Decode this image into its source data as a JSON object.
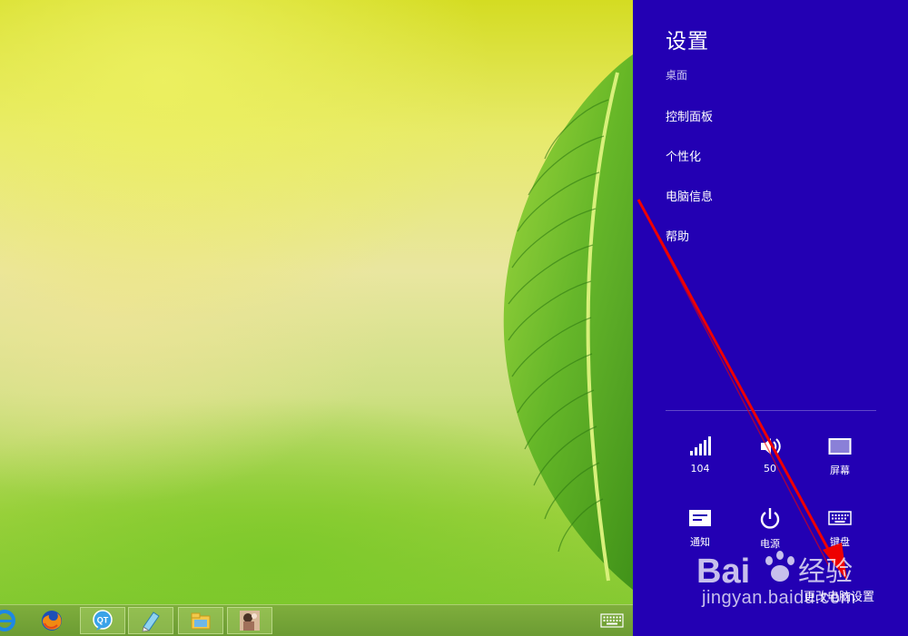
{
  "settings_pane": {
    "title": "设置",
    "subtitle": "桌面",
    "links": [
      {
        "label": "控制面板"
      },
      {
        "label": "个性化"
      },
      {
        "label": "电脑信息"
      },
      {
        "label": "帮助"
      }
    ],
    "quick_settings": {
      "network": {
        "icon": "network-signal-icon",
        "label": "104"
      },
      "volume": {
        "icon": "speaker-volume-icon",
        "label": "50"
      },
      "screen": {
        "icon": "screen-brightness-icon",
        "label": "屏幕"
      },
      "notifications": {
        "icon": "notifications-icon",
        "label": "通知"
      },
      "power": {
        "icon": "power-icon",
        "label": "电源"
      },
      "keyboard": {
        "icon": "keyboard-icon",
        "label": "键盘"
      }
    },
    "change_pc_settings_label": "更改电脑设置",
    "background_color": "#2300b3"
  },
  "taskbar": {
    "buttons": [
      {
        "name": "internet-explorer",
        "icon": "internet-explorer-icon"
      },
      {
        "name": "firefox",
        "icon": "firefox-icon"
      },
      {
        "name": "qt-messenger",
        "icon": "qt-chat-icon"
      },
      {
        "name": "notepad-app",
        "icon": "notepad-icon"
      },
      {
        "name": "file-explorer",
        "icon": "folder-icon"
      },
      {
        "name": "photo-app",
        "icon": "photo-thumbnail-icon"
      }
    ],
    "tray_icon": "touch-keyboard-icon"
  },
  "watermark": {
    "logo_text": "Bai 经验",
    "url": "jingyan.baidu.com"
  },
  "annotation": {
    "arrow_color": "#ee0000"
  }
}
